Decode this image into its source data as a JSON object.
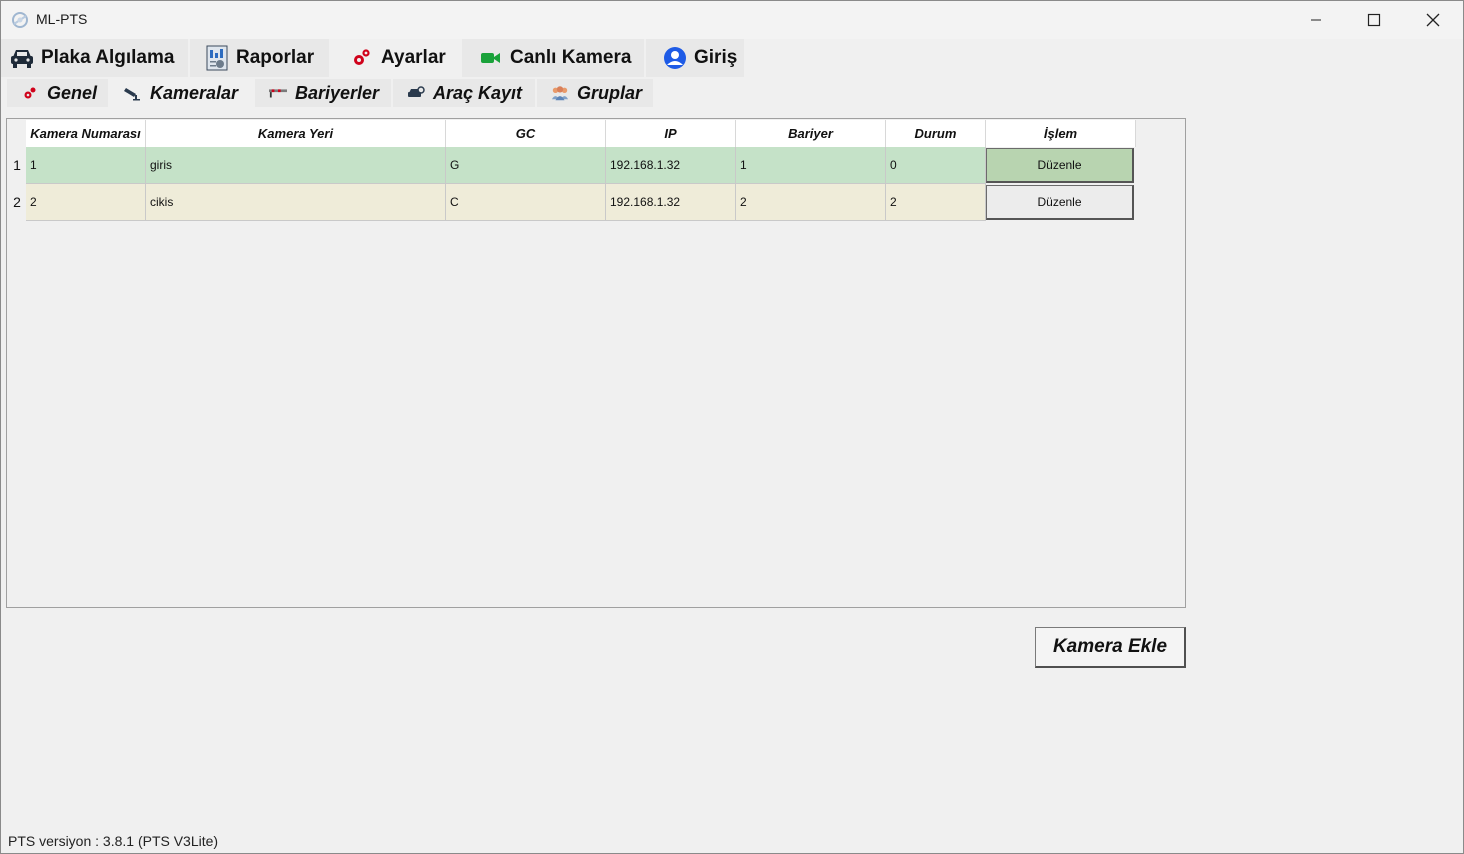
{
  "window": {
    "title": "ML-PTS"
  },
  "main_tabs": [
    {
      "label": "Plaka Algılama",
      "icon": "car-icon"
    },
    {
      "label": "Raporlar",
      "icon": "report-icon"
    },
    {
      "label": "Ayarlar",
      "icon": "gears-icon",
      "active": true
    },
    {
      "label": "Canlı Kamera",
      "icon": "video-camera-icon"
    },
    {
      "label": "Giriş",
      "icon": "user-icon"
    }
  ],
  "sub_tabs": [
    {
      "label": "Genel",
      "icon": "gears-icon"
    },
    {
      "label": "Kameralar",
      "icon": "security-camera-icon",
      "active": true
    },
    {
      "label": "Bariyerler",
      "icon": "barrier-icon"
    },
    {
      "label": "Araç Kayıt",
      "icon": "car-key-icon"
    },
    {
      "label": "Gruplar",
      "icon": "group-icon"
    }
  ],
  "table": {
    "headers": [
      "Kamera Numarası",
      "Kamera Yeri",
      "GC",
      "IP",
      "Bariyer",
      "Durum",
      "İşlem"
    ],
    "rows": [
      {
        "num": "1",
        "cells": [
          "1",
          "giris",
          "G",
          "192.168.1.32",
          "1",
          "0"
        ],
        "action": "Düzenle"
      },
      {
        "num": "2",
        "cells": [
          "2",
          "cikis",
          "C",
          "192.168.1.32",
          "2",
          "2"
        ],
        "action": "Düzenle"
      }
    ]
  },
  "add_button": "Kamera Ekle",
  "status": "PTS versiyon : 3.8.1 (PTS V3Lite)",
  "colors": {
    "row1": "#c5e2c8",
    "row2": "#efecd9",
    "button_row1": "#b8d4b0",
    "accent_red": "#d0021b",
    "accent_green": "#1aa23a",
    "accent_blue": "#1e5be6"
  }
}
